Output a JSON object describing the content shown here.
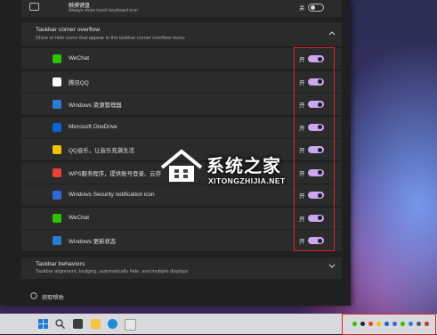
{
  "touch_keyboard": {
    "title": "触摸键盘",
    "subtitle": "Always show touch keyboard icon",
    "state": "关"
  },
  "overflow": {
    "title": "Taskbar corner overflow",
    "subtitle": "Show or hide icons that appear in the taskbar corner overflow menu",
    "items": [
      {
        "label": "WeChat",
        "state": "开",
        "icon": "wechat-icon",
        "color": "#2dc100"
      },
      {
        "label": "腾讯QQ",
        "state": "开",
        "icon": "qq-icon",
        "color": "#ffffff"
      },
      {
        "label": "Windows 资源管理器",
        "state": "开",
        "icon": "windows-icon",
        "color": "#2b7cd3"
      },
      {
        "label": "Microsoft OneDrive",
        "state": "开",
        "icon": "cloud-icon",
        "color": "#0a64d6"
      },
      {
        "label": "QQ音乐，让音乐充满生活",
        "state": "开",
        "icon": "music-icon",
        "color": "#f2c400"
      },
      {
        "label": "WPS服务程序，提供账号登录、云存",
        "state": "开",
        "icon": "wps-icon",
        "color": "#e9403a"
      },
      {
        "label": "Windows Security notification icon",
        "state": "开",
        "icon": "shield-icon",
        "color": "#2f6bd8"
      },
      {
        "label": "WeChat",
        "state": "开",
        "icon": "wechat-icon",
        "color": "#2dc100"
      },
      {
        "label": "Windows 更新状态",
        "state": "开",
        "icon": "update-icon",
        "color": "#2b7cd3"
      }
    ]
  },
  "behaviors": {
    "title": "Taskbar behaviors",
    "subtitle": "Taskbar alignment, badging, automatically hide, and multiple displays"
  },
  "help": {
    "label": "获取帮助"
  },
  "watermark": {
    "cn": "系统之家",
    "en": "XITONGZHIJIA.NET"
  },
  "colors": {
    "accent": "#c9a8f0",
    "highlight": "#d3272e"
  }
}
